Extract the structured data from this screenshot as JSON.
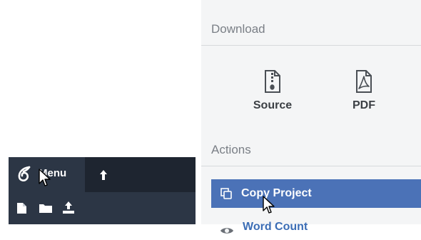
{
  "toolbar": {
    "menu_label": "Menu",
    "logo_icon": "overleaf-leaf-icon",
    "top_icons": [
      "upload-arrow-icon"
    ],
    "bottom_icons": [
      "new-file-icon",
      "new-folder-icon",
      "upload-icon"
    ]
  },
  "panel": {
    "download": {
      "title": "Download",
      "items": [
        {
          "label": "Source",
          "icon": "zip-file-icon"
        },
        {
          "label": "PDF",
          "icon": "pdf-file-icon"
        }
      ]
    },
    "actions": {
      "title": "Actions",
      "items": [
        {
          "label": "Copy Project",
          "icon": "copy-icon"
        },
        {
          "label": "Word Count",
          "icon": "eye-icon"
        }
      ]
    }
  },
  "colors": {
    "toolbar_bg": "#2c3645",
    "toolbar_dark": "#1e2530",
    "panel_bg": "#f4f5f6",
    "active_row": "#4b72b7"
  }
}
